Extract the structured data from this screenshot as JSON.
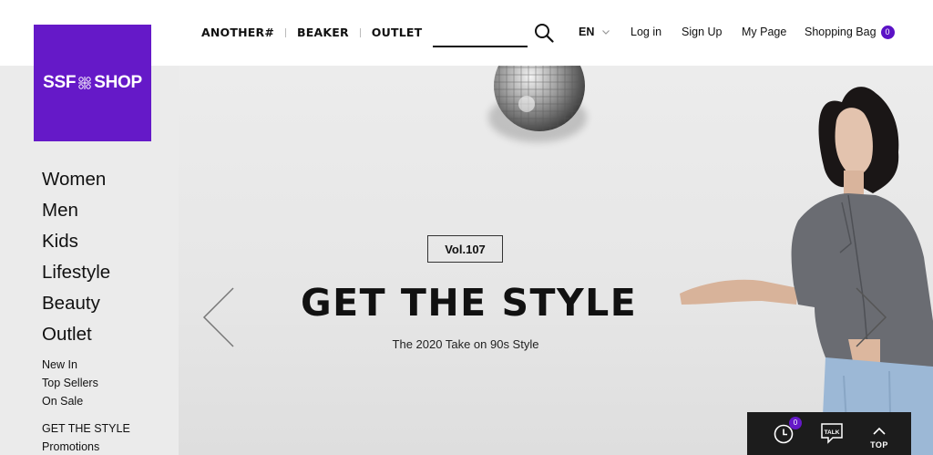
{
  "header": {
    "brands": [
      "ANOTHER#",
      "BEAKER",
      "OUTLET"
    ],
    "language": "EN",
    "login_label": "Log in",
    "signup_label": "Sign Up",
    "mypage_label": "My Page",
    "bag_label": "Shopping Bag",
    "bag_count": "0"
  },
  "logo": {
    "left": "SSF",
    "right": "SHOP"
  },
  "sidebar": {
    "main": [
      "Women",
      "Men",
      "Kids",
      "Lifestyle",
      "Beauty",
      "Outlet"
    ],
    "sub": [
      "New In",
      "Top Sellers",
      "On Sale"
    ],
    "sub2": [
      "GET THE STYLE",
      "Promotions"
    ]
  },
  "hero": {
    "volume": "Vol.107",
    "title": "GET THE STYLE",
    "subtitle": "The 2020 Take on 90s Style"
  },
  "quickbar": {
    "recent_count": "0",
    "talk_label": "TALK",
    "top_label": "TOP"
  },
  "colors": {
    "accent": "#6519c8",
    "bar": "#1c1c1c"
  }
}
